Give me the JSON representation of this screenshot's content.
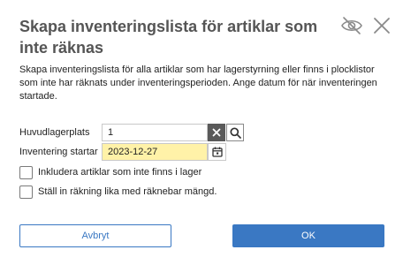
{
  "dialog": {
    "title": "Skapa inventeringslista för artiklar som inte räknas",
    "description": "Skapa inventeringslista för alla artiklar som har lagerstyrning eller finns i plocklistor som inte har räknats under inventeringsperioden. Ange datum för när inventeringen startade."
  },
  "icons": {
    "visibility": "eye-off-icon",
    "close": "close-icon",
    "clear": "clear-icon",
    "search": "search-icon",
    "calendar": "calendar-icon"
  },
  "form": {
    "main_warehouse": {
      "label": "Huvudlagerplats",
      "value": "1"
    },
    "inventory_start": {
      "label": "Inventering startar",
      "value": "2023-12-27"
    },
    "include_not_in_stock": {
      "label": "Inkludera artiklar som inte finns i lager",
      "checked": false
    },
    "set_count_equal": {
      "label": "Ställ in räkning lika med räknebar mängd.",
      "checked": false
    }
  },
  "buttons": {
    "cancel": "Avbryt",
    "ok": "OK"
  },
  "colors": {
    "accent": "#3a78c3",
    "date_highlight": "#fff2a8",
    "title": "#555555"
  }
}
